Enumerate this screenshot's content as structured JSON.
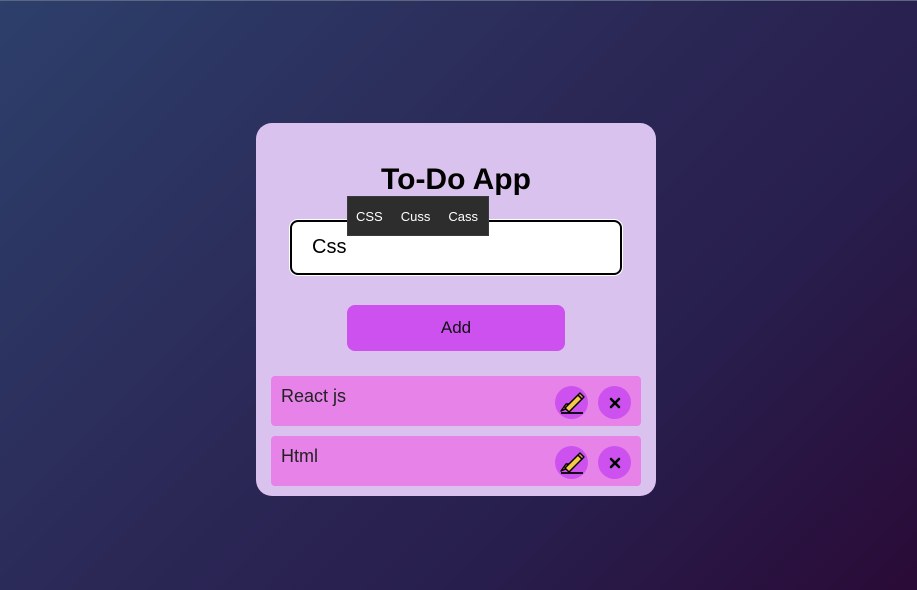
{
  "app": {
    "title": "To-Do App"
  },
  "input": {
    "value": "Css",
    "placeholder": ""
  },
  "autocomplete": {
    "suggestions": [
      "CSS",
      "Cuss",
      "Cass"
    ]
  },
  "add_button": {
    "label": "Add"
  },
  "todos": [
    {
      "text": "React js",
      "edit_icon": "pencil-writing-icon",
      "delete_icon": "close-x-icon"
    },
    {
      "text": "Html",
      "edit_icon": "pencil-writing-icon",
      "delete_icon": "close-x-icon"
    }
  ],
  "colors": {
    "card_background": "#d9c3ee",
    "accent": "#cd51ef",
    "todo_background": "#e682e8",
    "suggestion_background": "#2d2d2d"
  }
}
